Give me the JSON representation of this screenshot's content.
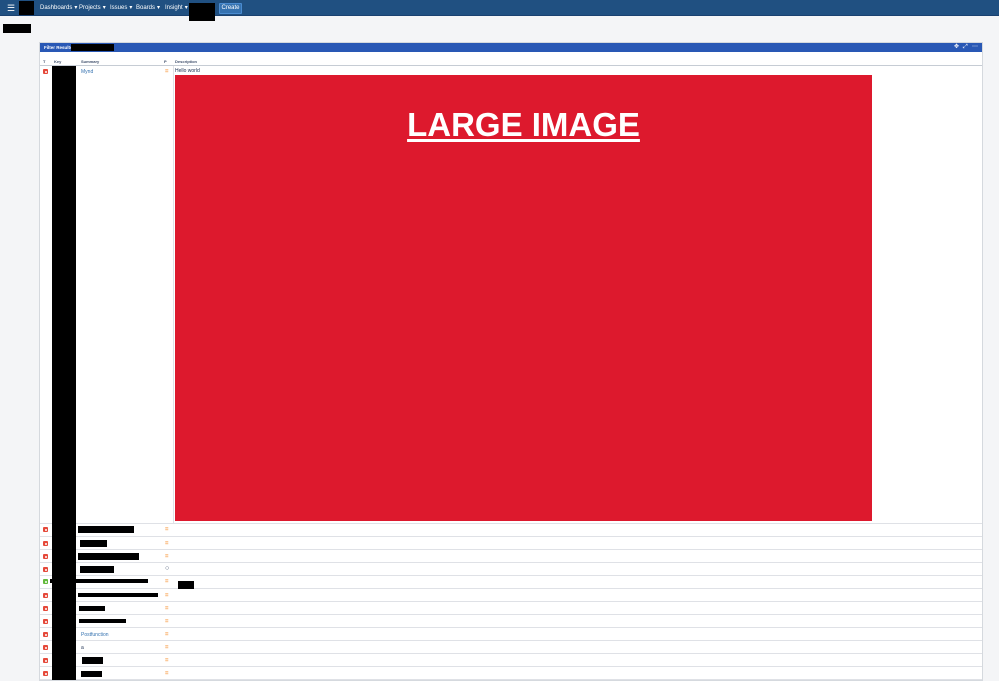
{
  "nav": {
    "menu_icon": "grid-menu-icon",
    "items": [
      {
        "label": "Dashboards"
      },
      {
        "label": "Projects"
      },
      {
        "label": "Issues"
      },
      {
        "label": "Boards"
      },
      {
        "label": "Insight"
      }
    ],
    "chevron": "▾",
    "create_label": "Create"
  },
  "gadget": {
    "title": "Filter Results",
    "icons": [
      "move-icon",
      "expand-icon",
      "more-icon"
    ],
    "columns": {
      "type": "T",
      "key": "Key",
      "summary": "Summary",
      "priority": "P",
      "description": "Description"
    }
  },
  "rows": [
    {
      "type": "bug",
      "summary": "Mynd",
      "priority": "=",
      "description": "Hello world",
      "image_text": "LARGE IMAGE"
    },
    {
      "type": "bug",
      "summary": "",
      "priority": "="
    },
    {
      "type": "bug",
      "summary": "",
      "priority": "="
    },
    {
      "type": "bug",
      "summary": "",
      "priority": "="
    },
    {
      "type": "bug",
      "summary": "",
      "priority": "○"
    },
    {
      "type": "story",
      "summary": "",
      "priority": "="
    },
    {
      "type": "bug",
      "summary": "",
      "priority": "="
    },
    {
      "type": "bug",
      "summary": "",
      "priority": "="
    },
    {
      "type": "bug",
      "summary": "",
      "priority": "="
    },
    {
      "type": "bug",
      "summary": "Postfunction",
      "priority": "="
    },
    {
      "type": "bug",
      "summary": "a",
      "priority": "="
    },
    {
      "type": "bug",
      "summary": "",
      "priority": "="
    },
    {
      "type": "bug",
      "summary": "",
      "priority": "="
    }
  ],
  "colors": {
    "nav_bg": "#205081",
    "gadget_header": "#2958b5",
    "bug": "#e5493a",
    "story": "#63ba3c",
    "image_bg": "#dd192d",
    "link": "#3572b0"
  }
}
